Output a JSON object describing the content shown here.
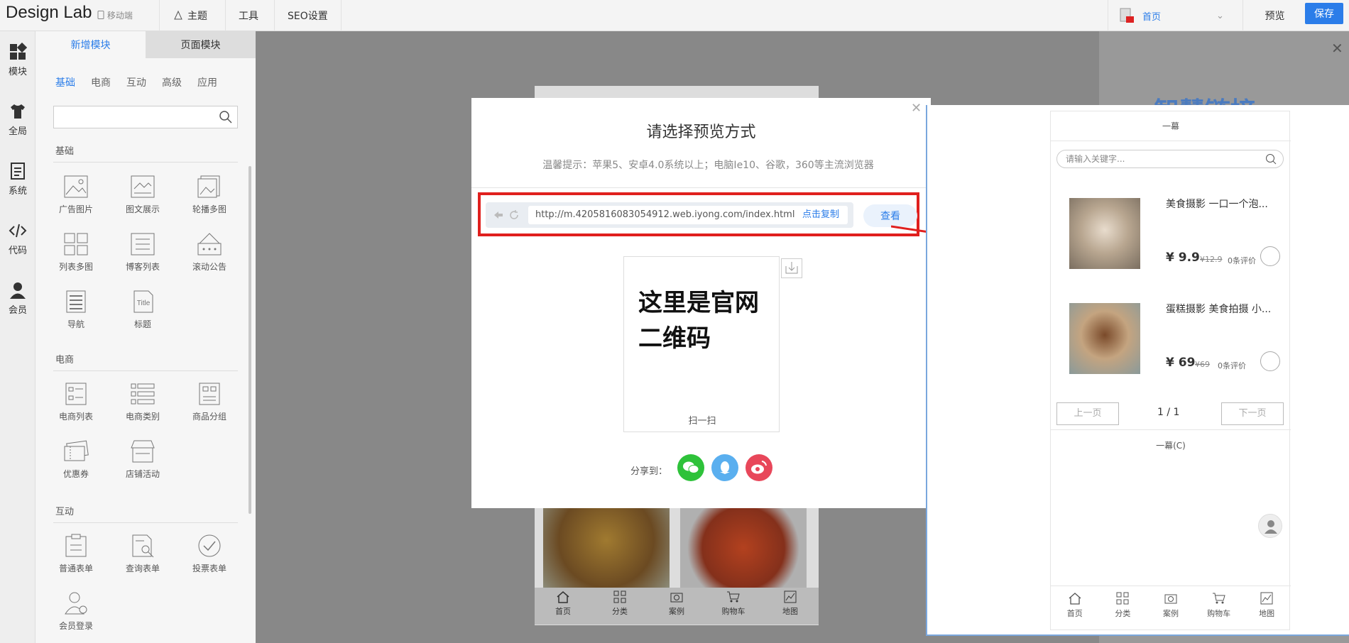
{
  "topbar": {
    "brand": "Design Lab",
    "mobile": "移动端",
    "nav": [
      "主题",
      "工具",
      "SEO设置"
    ],
    "lang_label": "首页",
    "preview": "预览",
    "save": "保存"
  },
  "rail": {
    "items": [
      "模块",
      "全局",
      "系统",
      "代码",
      "会员"
    ]
  },
  "panel": {
    "tabs": [
      "新增模块",
      "页面模块"
    ],
    "subtabs": [
      "基础",
      "电商",
      "互动",
      "高级",
      "应用"
    ],
    "section_basic": "基础",
    "basic_items": [
      "广告图片",
      "图文展示",
      "轮播多图",
      "列表多图",
      "博客列表",
      "滚动公告",
      "导航",
      "标题"
    ],
    "section_ecom": "电商",
    "ecom_items": [
      "电商列表",
      "电商类别",
      "商品分组",
      "优惠券",
      "店铺活动"
    ],
    "section_inter": "互动",
    "inter_items": [
      "普通表单",
      "查询表单",
      "投票表单",
      "会员登录"
    ]
  },
  "modal": {
    "title": "请选择预览方式",
    "tip": "温馨提示：苹果5、安卓4.0系统以上；电脑Ie10、谷歌，360等主流浏览器",
    "url": "http://m.4205816083054912.web.iyong.com/index.html",
    "copy": "点击复制",
    "view": "查看",
    "qr_text": "这里是官网二维码",
    "qr_scan": "扫一扫",
    "share": "分享到："
  },
  "preview": {
    "head": "一幕",
    "search_placeholder": "请输入关键字...",
    "products": [
      {
        "name": "美食摄影 一口一个泡...",
        "price": "¥ 9.9",
        "old": "¥12.9",
        "reviews": "0条评价"
      },
      {
        "name": "蛋糕摄影 美食拍摄 小...",
        "price": "¥ 69",
        "old": "¥69",
        "reviews": "0条评价"
      }
    ],
    "prev": "上一页",
    "page": "1 / 1",
    "next": "下一页",
    "footer": "一幕(C)",
    "nav": [
      "首页",
      "分类",
      "案例",
      "购物车",
      "地图"
    ]
  },
  "bg_nav": [
    "首页",
    "分类",
    "案例",
    "购物车",
    "地图"
  ],
  "right_title": "智慧链接",
  "colors": {
    "accent": "#2b7de9",
    "frame": "#e0201e",
    "wechat": "#2ec23a",
    "qq": "#5aafef",
    "weibo": "#e8475a"
  }
}
